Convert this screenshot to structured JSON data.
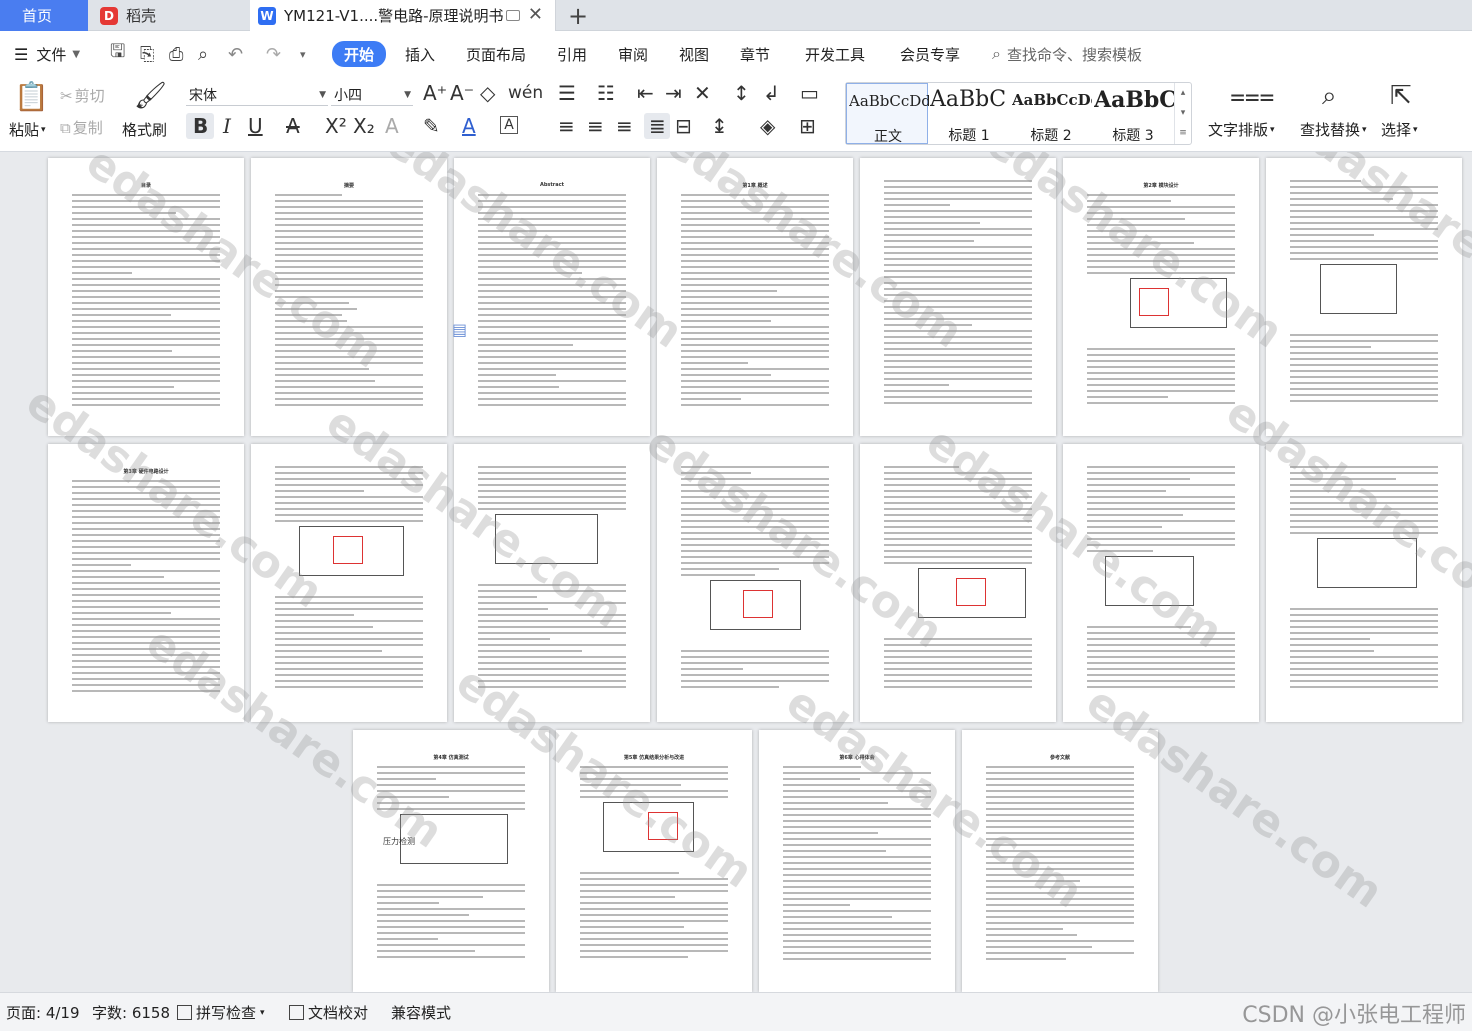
{
  "tabs": {
    "home": "首页",
    "daoke": "稻壳",
    "doc": "YM121-V1....警电路-原理说明书"
  },
  "menu": {
    "file": "文件",
    "start": "开始",
    "insert": "插入",
    "layout": "页面布局",
    "reference": "引用",
    "review": "审阅",
    "view": "视图",
    "chapter": "章节",
    "devtools": "开发工具",
    "member": "会员专享",
    "search": "查找命令、搜索模板"
  },
  "ribbon": {
    "paste": "粘贴",
    "cut": "剪切",
    "copy": "复制",
    "format_painter": "格式刷",
    "font_name": "宋体",
    "font_size": "小四",
    "styles": [
      {
        "sample": "AaBbCcDd",
        "label": "正文"
      },
      {
        "sample": "AaBbC",
        "label": "标题 1"
      },
      {
        "sample": "AaBbCcDd",
        "label": "标题 2"
      },
      {
        "sample": "AaBbC",
        "label": "标题 3"
      }
    ],
    "text_layout": "文字排版",
    "find_replace": "查找替换",
    "select": "选择"
  },
  "pages": {
    "toc_title": "目录",
    "abstract_cn": "摘要",
    "abstract_en": "Abstract",
    "ch1": "第1章 概述",
    "ch2": "第2章 模块设计",
    "ch3": "第3章 硬件电路设计",
    "ch4": "第4章 仿真测试",
    "ch5": "第5章 仿真结果分析与改进",
    "ch6": "第6章 心得体会",
    "refs": "参考文献",
    "fig_label": "压力检测"
  },
  "watermark": "edashare.com",
  "status": {
    "page": "页面: 4/19",
    "words": "字数: 6158",
    "spell": "拼写检查",
    "proof": "文档校对",
    "compat": "兼容模式",
    "csdn": "CSDN @小张电工程师"
  }
}
